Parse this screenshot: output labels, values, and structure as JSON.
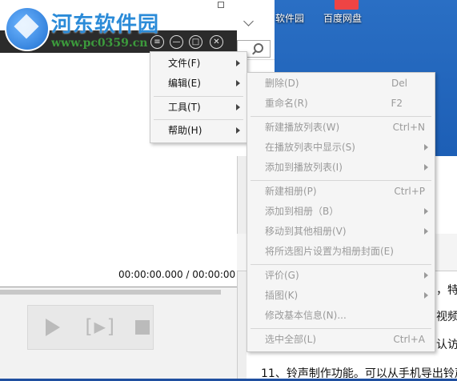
{
  "desktop": {
    "icons": [
      {
        "label": "软件园"
      },
      {
        "label": "百度网盘"
      }
    ],
    "help_icon": "?"
  },
  "watermark": {
    "title": "河东软件园",
    "url": "www.pc0359.cn"
  },
  "explorer": {
    "column_header": "度"
  },
  "player": {
    "title_buttons": [
      "≡",
      "—",
      "□",
      "✕"
    ],
    "timecode": "00:00:00.000 / 00:00:00",
    "icons": [
      "play-icon",
      "step-frame-icon",
      "stop-icon"
    ]
  },
  "main_menu": {
    "items": [
      {
        "label": "文件(F)",
        "submenu": true
      },
      {
        "label": "编辑(E)",
        "submenu": true
      },
      {
        "label": "工具(T)",
        "submenu": true
      },
      {
        "label": "帮助(H)",
        "submenu": true
      }
    ]
  },
  "sub_menu": {
    "items": [
      {
        "label": "删除(D)",
        "shortcut": "Del"
      },
      {
        "label": "重命名(R)",
        "shortcut": "F2"
      },
      {
        "label": "新建播放列表(W)",
        "shortcut": "Ctrl+N"
      },
      {
        "label": "在播放列表中显示(S)",
        "submenu": true
      },
      {
        "label": "添加到播放列表(I)",
        "submenu": true
      },
      {
        "label": "新建相册(P)",
        "shortcut": "Ctrl+P"
      },
      {
        "label": "添加到相册（B）",
        "submenu": true
      },
      {
        "label": "移动到其他相册(V)",
        "submenu": true
      },
      {
        "label": "将所选图片设置为相册封面(E)"
      },
      {
        "label": "评价(G)",
        "submenu": true
      },
      {
        "label": "插图(K)",
        "submenu": true
      },
      {
        "label": "修改基本信息(N)..."
      },
      {
        "label": "选中全部(L)",
        "shortcut": "Ctrl+A"
      }
    ]
  },
  "right_window": {
    "search_label": "搜索",
    "doc_lines": [
      "，特另",
      "视频",
      "认访问",
      "11、铃声制作功能。可以从手机导出铃声"
    ]
  }
}
